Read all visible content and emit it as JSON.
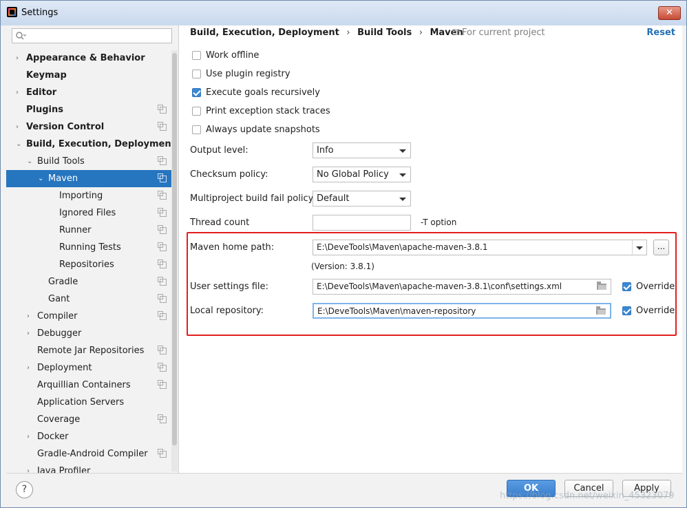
{
  "window": {
    "title": "Settings",
    "close_label": "✕"
  },
  "sidebar": {
    "search_placeholder": "",
    "items": [
      {
        "label": "Appearance & Behavior",
        "arrow": "›"
      },
      {
        "label": "Keymap",
        "arrow": ""
      },
      {
        "label": "Editor",
        "arrow": "›"
      },
      {
        "label": "Plugins",
        "arrow": ""
      },
      {
        "label": "Version Control",
        "arrow": "›"
      },
      {
        "label": "Build, Execution, Deployment",
        "arrow": "⌄"
      },
      {
        "label": "Build Tools",
        "arrow": "⌄"
      },
      {
        "label": "Maven",
        "arrow": "⌄"
      },
      {
        "label": "Importing",
        "arrow": ""
      },
      {
        "label": "Ignored Files",
        "arrow": ""
      },
      {
        "label": "Runner",
        "arrow": ""
      },
      {
        "label": "Running Tests",
        "arrow": ""
      },
      {
        "label": "Repositories",
        "arrow": ""
      },
      {
        "label": "Gradle",
        "arrow": ""
      },
      {
        "label": "Gant",
        "arrow": ""
      },
      {
        "label": "Compiler",
        "arrow": "›"
      },
      {
        "label": "Debugger",
        "arrow": "›"
      },
      {
        "label": "Remote Jar Repositories",
        "arrow": ""
      },
      {
        "label": "Deployment",
        "arrow": "›"
      },
      {
        "label": "Arquillian Containers",
        "arrow": ""
      },
      {
        "label": "Application Servers",
        "arrow": ""
      },
      {
        "label": "Coverage",
        "arrow": ""
      },
      {
        "label": "Docker",
        "arrow": "›"
      },
      {
        "label": "Gradle-Android Compiler",
        "arrow": ""
      },
      {
        "label": "Java Profiler",
        "arrow": "›"
      }
    ]
  },
  "main": {
    "breadcrumb": [
      "Build, Execution, Deployment",
      "Build Tools",
      "Maven"
    ],
    "breadcrumb_sep": "›",
    "for_current_project": "For current project",
    "reset_label": "Reset",
    "checkboxes": [
      {
        "label": "Work offline",
        "checked": false
      },
      {
        "label": "Use plugin registry",
        "checked": false
      },
      {
        "label": "Execute goals recursively",
        "checked": true
      },
      {
        "label": "Print exception stack traces",
        "checked": false
      },
      {
        "label": "Always update snapshots",
        "checked": false
      }
    ],
    "output_level": {
      "label": "Output level:",
      "value": "Info"
    },
    "checksum_policy": {
      "label": "Checksum policy:",
      "value": "No Global Policy"
    },
    "multiproject_policy": {
      "label": "Multiproject build fail policy:",
      "value": "Default"
    },
    "thread_count": {
      "label": "Thread count",
      "value": "",
      "suffix": "-T option"
    },
    "maven_home": {
      "label": "Maven home path:",
      "value": "E:\\DeveTools\\Maven\\apache-maven-3.8.1",
      "browse_label": "...",
      "version": "(Version: 3.8.1)"
    },
    "user_settings": {
      "label": "User settings file:",
      "value": "E:\\DeveTools\\Maven\\apache-maven-3.8.1\\conf\\settings.xml",
      "override_label": "Override",
      "override_checked": true
    },
    "local_repo": {
      "label": "Local repository:",
      "value": "E:\\DeveTools\\Maven\\maven-repository",
      "override_label": "Override",
      "override_checked": true
    }
  },
  "footer": {
    "help_label": "?",
    "ok_label": "OK",
    "cancel_label": "Cancel",
    "apply_label": "Apply"
  },
  "watermark": "https://blog.csdn.net/weixin_45323079"
}
